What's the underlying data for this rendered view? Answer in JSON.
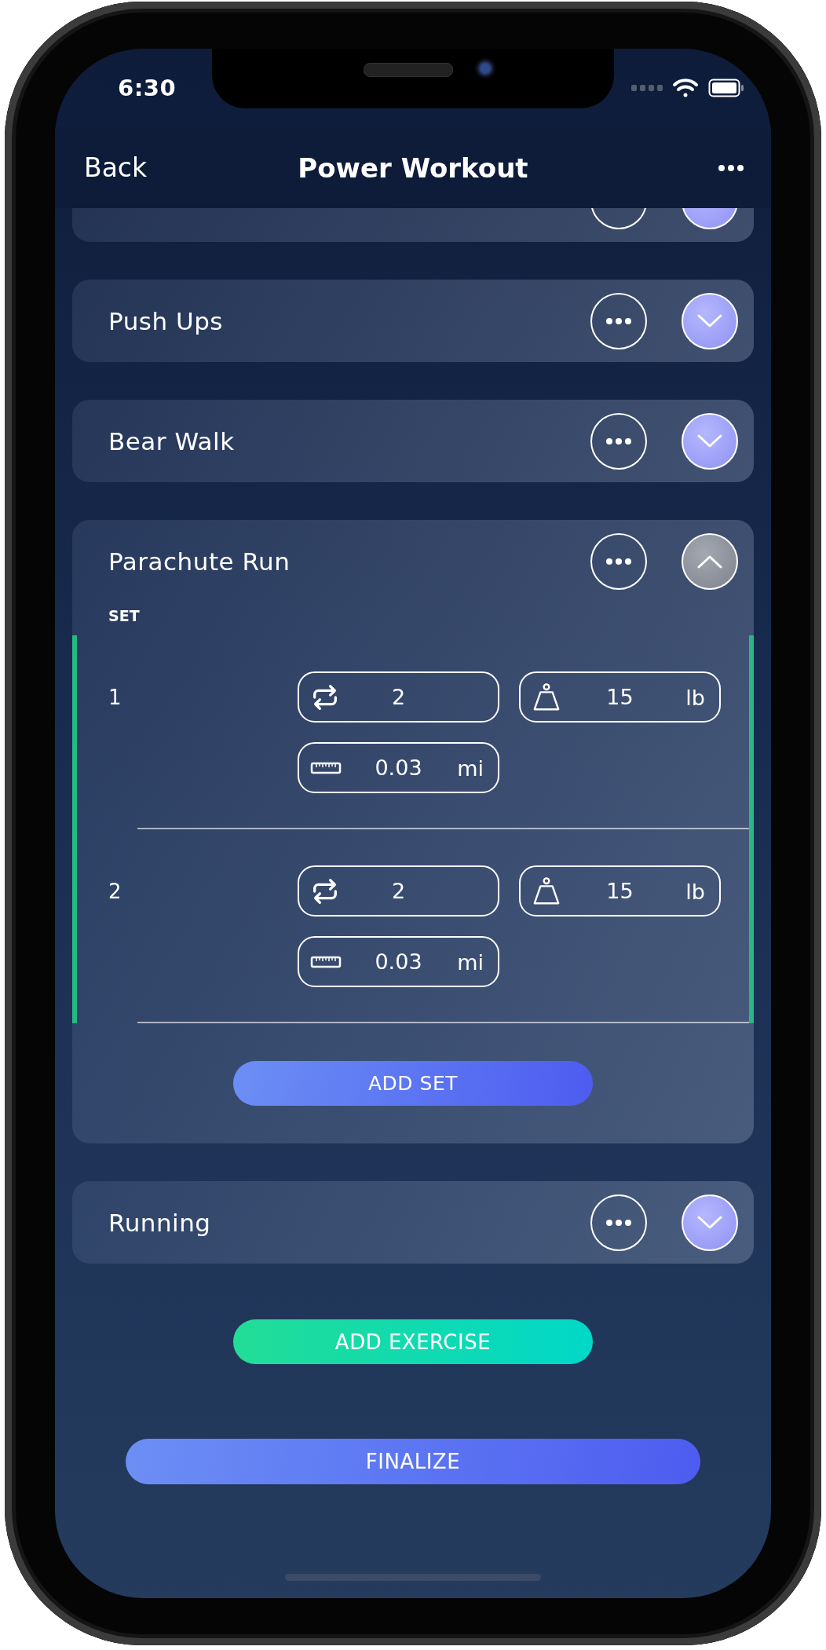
{
  "status_bar": {
    "time": "6:30"
  },
  "header": {
    "back": "Back",
    "title": "Power Workout"
  },
  "exercises": [
    {
      "expanded": false
    },
    {
      "name": "Push Ups",
      "expanded": false
    },
    {
      "name": "Bear Walk",
      "expanded": false
    },
    {
      "name": "Parachute Run",
      "expanded": true,
      "set_label": "SET",
      "add_set": "ADD SET",
      "sets": [
        {
          "number": "1",
          "metrics": [
            {
              "kind": "reps",
              "value": "2"
            },
            {
              "kind": "weight",
              "value": "15",
              "unit": "lb"
            },
            {
              "kind": "distance",
              "value": "0.03",
              "unit": "mi"
            }
          ]
        },
        {
          "number": "2",
          "metrics": [
            {
              "kind": "reps",
              "value": "2"
            },
            {
              "kind": "weight",
              "value": "15",
              "unit": "lb"
            },
            {
              "kind": "distance",
              "value": "0.03",
              "unit": "mi"
            }
          ]
        }
      ]
    },
    {
      "name": "Running",
      "expanded": false
    }
  ],
  "add_exercise": "ADD EXERCISE",
  "finalize": "FINALIZE"
}
